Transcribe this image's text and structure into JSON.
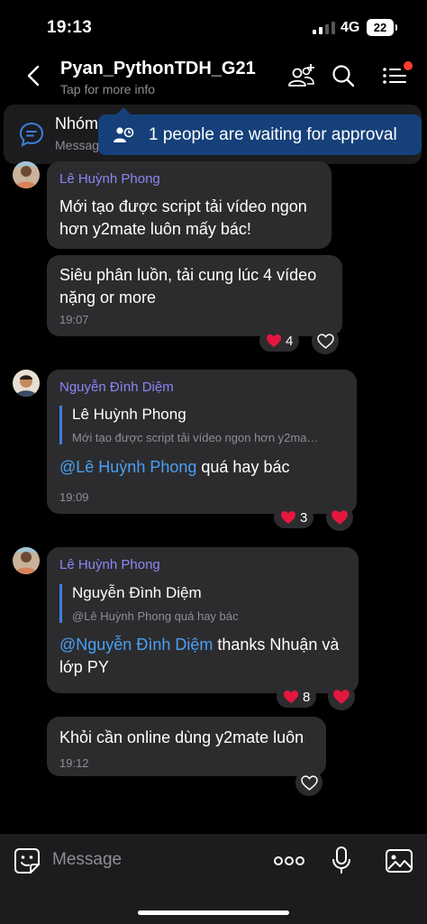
{
  "status": {
    "time": "19:13",
    "network": "4G",
    "battery": "22"
  },
  "header": {
    "title": "Pyan_PythonTDH_G21",
    "subtitle": "Tap for more info"
  },
  "pinned": {
    "title": "Nhóm",
    "subtitle": "Messag"
  },
  "approval_banner": {
    "text": "1 people are waiting for approval"
  },
  "messages": [
    {
      "sender": "Lê Huỳnh Phong",
      "text_line1": "Mới tạo được script tải vídeo ngon",
      "text_line2": "hơn y2mate luôn mấy bác!"
    },
    {
      "text_line1": "Siêu phân luồn, tải cung lúc 4 vídeo",
      "text_line2": "nặng or more",
      "time": "19:07",
      "reaction_count": "4"
    },
    {
      "sender": "Nguyễn Đình Diệm",
      "quote_name": "Lê Huỳnh Phong",
      "quote_text": "Mới tạo được script tải vídeo ngon hơn y2ma…",
      "mention": "@Lê Huỳnh Phong",
      "text": " quá hay bác",
      "time": "19:09",
      "reaction_count": "3"
    },
    {
      "sender": "Lê Huỳnh Phong",
      "quote_name": "Nguyễn Đình Diệm",
      "quote_text": "@Lê Huỳnh Phong quá hay bác",
      "mention": "@Nguyễn Đình Diệm",
      "text_line1": " thanks Nhuận và",
      "text_line2": "lớp PY",
      "reaction_count": "8"
    },
    {
      "text": "Khỏi cần online dùng y2mate luôn",
      "time": "19:12"
    }
  ],
  "composer": {
    "placeholder": "Message"
  },
  "icons": {
    "back": "chevron-left-icon",
    "add_members": "add-people-icon",
    "search": "search-icon",
    "menu": "list-menu-icon",
    "pinned": "chat-bubble-icon",
    "approval": "person-clock-icon",
    "heart": "heart-icon",
    "emoji": "sticker-icon",
    "more": "more-dots-icon",
    "mic": "microphone-icon",
    "gallery": "gallery-icon"
  },
  "colors": {
    "accent": "#3d7fe0",
    "banner": "#15407a",
    "sender": "#8a87f5",
    "heart": "#e5173f"
  }
}
